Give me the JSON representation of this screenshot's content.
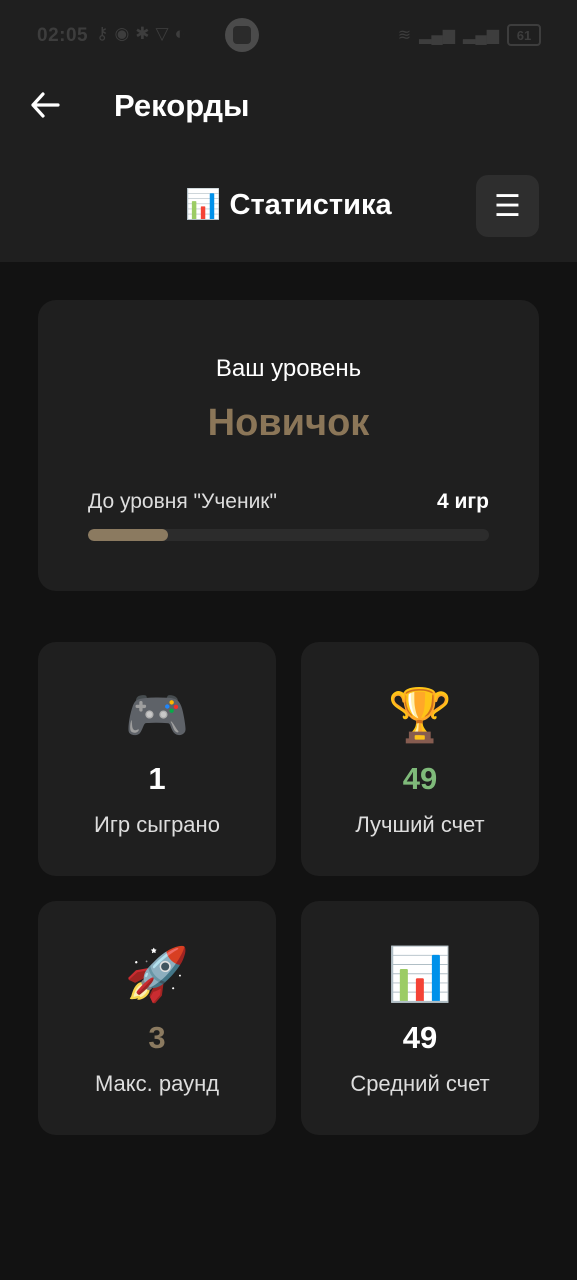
{
  "status_bar": {
    "time": "02:05",
    "battery": "61"
  },
  "header": {
    "title": "Рекорды",
    "subtitle": "Статистика",
    "subtitle_icon": "📊"
  },
  "level": {
    "label": "Ваш уровень",
    "name": "Новичок",
    "name_color": "#8b7658",
    "progress_text": "До уровня \"Ученик\"",
    "progress_count": "4 игр",
    "progress_fraction": 0.2
  },
  "stats": [
    {
      "icon": "🎮",
      "icon_name": "gamepad-icon",
      "value": "1",
      "label": "Игр сыграно",
      "color": "#ffffff"
    },
    {
      "icon": "🏆",
      "icon_name": "trophy-icon",
      "value": "49",
      "label": "Лучший счет",
      "color": "#7fba7a"
    },
    {
      "icon": "🚀",
      "icon_name": "rocket-icon",
      "value": "3",
      "label": "Макс. раунд",
      "color": "#8b7a60"
    },
    {
      "icon": "📊",
      "icon_name": "bar-chart-icon",
      "value": "49",
      "label": "Средний счет",
      "color": "#ffffff"
    }
  ]
}
